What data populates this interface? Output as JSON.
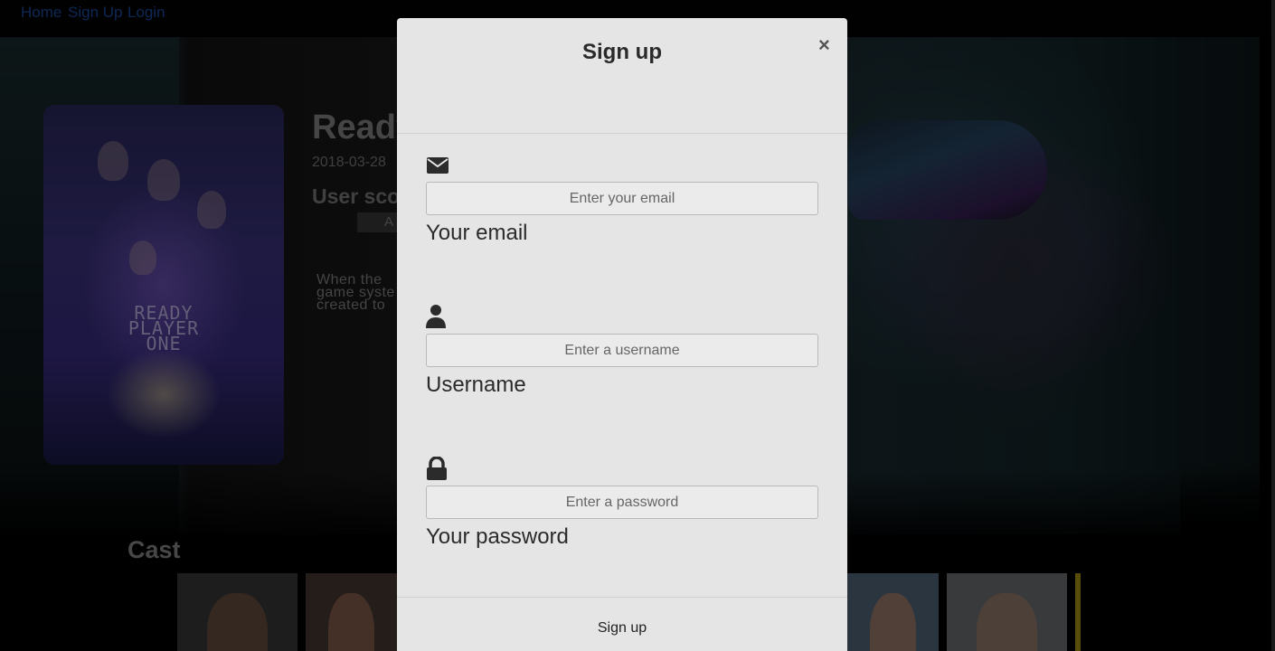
{
  "nav": {
    "home": "Home",
    "signup": "Sign Up",
    "login": "Login"
  },
  "movie": {
    "title": "Ready",
    "date": "2018-03-28",
    "user_score": "User sco",
    "rating": "A",
    "overview_lines": [
      "When the",
      "game syste",
      "created to"
    ],
    "poster_text": [
      "READY",
      "PLAYER",
      "ONE"
    ]
  },
  "cast": {
    "heading": "Cast"
  },
  "modal": {
    "title": "Sign up",
    "close": "×",
    "email": {
      "placeholder": "Enter your email",
      "label": "Your email"
    },
    "username": {
      "placeholder": "Enter a username",
      "label": "Username"
    },
    "password": {
      "placeholder": "Enter a password",
      "label": "Your password"
    },
    "submit": "Sign up"
  },
  "colors": {
    "link": "#1d4fa8",
    "modal_bg": "#e5e5e5",
    "icon": "#2b2b2b"
  },
  "icons": {
    "email": "envelope-icon",
    "username": "user-icon",
    "password": "lock-icon",
    "close": "close-icon"
  }
}
